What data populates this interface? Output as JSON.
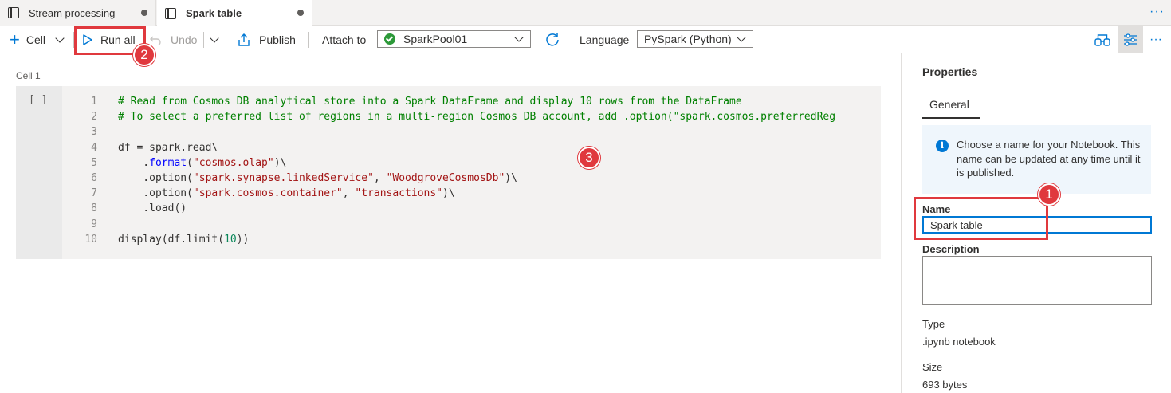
{
  "tabs": [
    {
      "label": "Stream processing"
    },
    {
      "label": "Spark table"
    }
  ],
  "toolbar": {
    "cell_label": "Cell",
    "run_all_label": "Run all",
    "undo_label": "Undo",
    "publish_label": "Publish",
    "attach_to_label": "Attach to",
    "spark_pool": "SparkPool01",
    "language_label": "Language",
    "language_value": "PySpark (Python)"
  },
  "notebook": {
    "cell_title": "Cell 1",
    "exec_count": "[ ]",
    "line_numbers": [
      "1",
      "2",
      "3",
      "4",
      "5",
      "6",
      "7",
      "8",
      "9",
      "10"
    ],
    "code": {
      "l1": "# Read from Cosmos DB analytical store into a Spark DataFrame and display 10 rows from the DataFrame",
      "l2": "# To select a preferred list of regions in a multi-region Cosmos DB account, add .option(\"spark.cosmos.preferredReg",
      "l4": "df = spark.read\\",
      "l5_a": "    .",
      "l5_fn": "format",
      "l5_b": "(",
      "l5_str": "\"cosmos.olap\"",
      "l5_c": ")\\",
      "l6_a": "    .option(",
      "l6_s1": "\"spark.synapse.linkedService\"",
      "l6_b": ", ",
      "l6_s2": "\"WoodgroveCosmosDb\"",
      "l6_c": ")\\",
      "l7_a": "    .option(",
      "l7_s1": "\"spark.cosmos.container\"",
      "l7_b": ", ",
      "l7_s2": "\"transactions\"",
      "l7_c": ")\\",
      "l8": "    .load()",
      "l10_a": "display(df.limit(",
      "l10_num": "10",
      "l10_b": "))"
    }
  },
  "properties": {
    "title": "Properties",
    "tab_general": "General",
    "info_text": "Choose a name for your Notebook. This name can be updated at any time until it is published.",
    "name_label": "Name",
    "name_value": "Spark table",
    "description_label": "Description",
    "type_label": "Type",
    "type_value": ".ipynb notebook",
    "size_label": "Size",
    "size_value": "693 bytes"
  },
  "callouts": [
    "1",
    "2",
    "3"
  ],
  "colors": {
    "accent": "#0078d4",
    "callout": "#e0393e",
    "success": "#2c9939"
  },
  "icons": [
    "notebook-icon",
    "plus-icon",
    "play-icon",
    "undo-icon",
    "publish-icon",
    "refresh-icon",
    "info-icon",
    "more-icon",
    "settings-icon",
    "variables-icon"
  ]
}
